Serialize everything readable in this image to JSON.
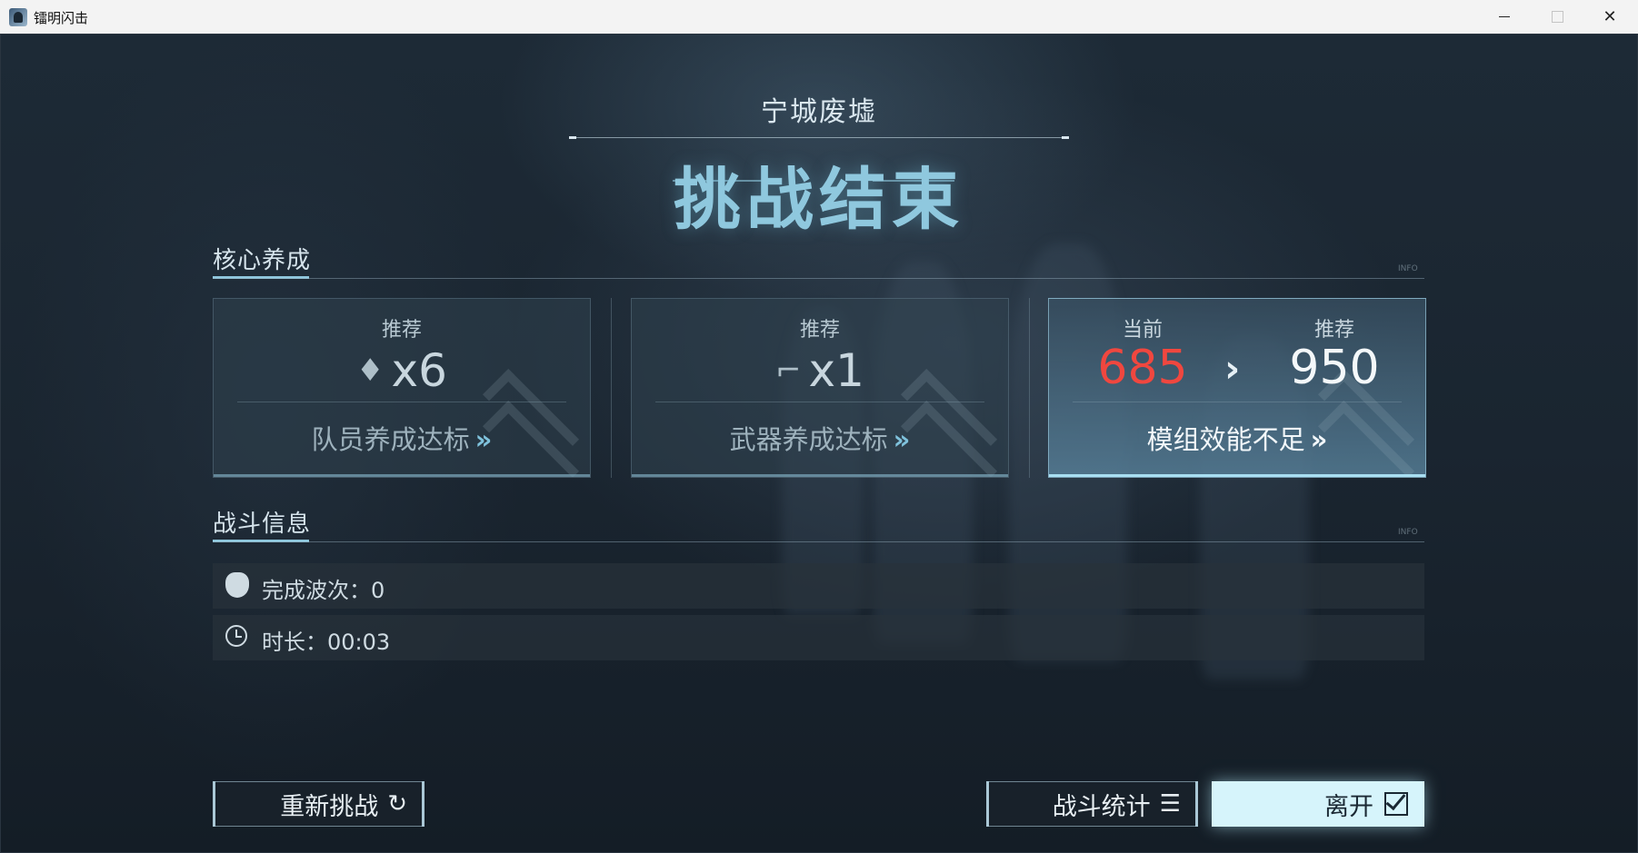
{
  "window": {
    "title": "镭明闪击",
    "min_icon": "minimize-icon",
    "max_icon": "maximize-icon",
    "close_icon": "close-icon"
  },
  "header": {
    "map_name": "宁城废墟",
    "result_title": "挑战结束"
  },
  "core": {
    "section_title": "核心养成",
    "info_tag": "INFO",
    "cards": [
      {
        "label": "推荐",
        "icon": "operator-icon",
        "value": "x6",
        "action": "队员养成达标"
      },
      {
        "label": "推荐",
        "icon": "gun-icon",
        "value": "x1",
        "action": "武器养成达标"
      }
    ],
    "module": {
      "current_label": "当前",
      "current_value": "685",
      "recommended_label": "推荐",
      "recommended_value": "950",
      "action": "模组效能不足"
    }
  },
  "battle": {
    "section_title": "战斗信息",
    "info_tag": "INFO",
    "waves": "完成波次：0",
    "duration": "时长：00:03"
  },
  "buttons": {
    "retry": "重新挑战",
    "stats": "战斗统计",
    "leave": "离开"
  },
  "colors": {
    "accent": "#8fc8de",
    "current_value": "#f0473f",
    "primary_button": "#d6f4fb"
  }
}
